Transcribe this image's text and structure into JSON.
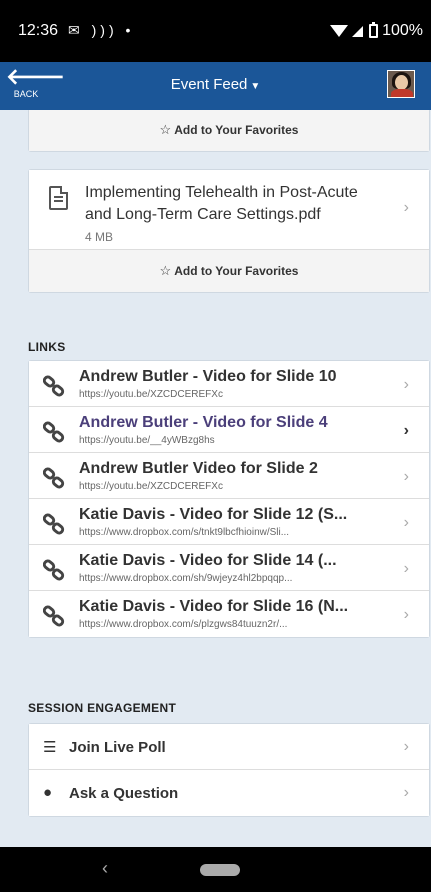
{
  "status_bar": {
    "time": "12:36",
    "notif_icons": "✉ ))) •",
    "battery": "100%"
  },
  "nav": {
    "back_label": "BACK",
    "title": "Event Feed",
    "avatar_icon": "user-avatar"
  },
  "files": {
    "top_favorite_label": "Add to Your Favorites",
    "items": [
      {
        "name": "Implementing Telehealth in Post-Acute and Long-Term Care Settings.pdf",
        "size": "4 MB",
        "favorite_label": "Add to Your Favorites"
      }
    ]
  },
  "links": {
    "header": "LINKS",
    "items": [
      {
        "title": "Andrew Butler - Video for Slide 10",
        "url": "https://youtu.be/XZCDCEREFXc"
      },
      {
        "title": "Andrew Butler - Video for Slide 4",
        "url": "https://youtu.be/__4yWBzg8hs"
      },
      {
        "title": "Andrew Butler Video for Slide 2",
        "url": "https://youtu.be/XZCDCEREFXc"
      },
      {
        "title": "Katie Davis - Video for Slide 12 (S...",
        "url": "https://www.dropbox.com/s/tnkt9lbcfhioinw/Sli..."
      },
      {
        "title": "Katie Davis - Video for Slide 14 (...",
        "url": "https://www.dropbox.com/sh/9wjeyz4hl2bpqqp..."
      },
      {
        "title": "Katie Davis - Video for Slide 16 (N...",
        "url": "https://www.dropbox.com/s/plzgws84tuuzn2r/..."
      }
    ]
  },
  "engagement": {
    "header": "SESSION ENGAGEMENT",
    "items": [
      {
        "label": "Join Live Poll",
        "icon": "list-icon"
      },
      {
        "label": "Ask a Question",
        "icon": "chat-bubble-icon"
      }
    ]
  },
  "colors": {
    "nav_bg": "#1b5698",
    "page_bg": "#e2eaf2",
    "active_link": "#4b3f7a"
  }
}
